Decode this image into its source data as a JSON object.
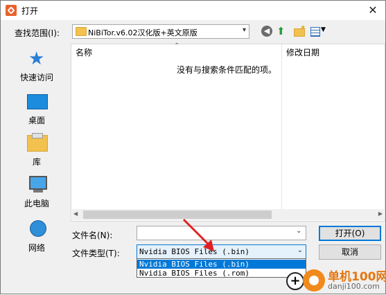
{
  "window": {
    "title": "打开",
    "close_glyph": "✕"
  },
  "lookin": {
    "label": "查找范围(I):",
    "value": "NiBiTor.v6.02汉化版+英文原版"
  },
  "toolbar": {
    "icons": [
      "back-icon",
      "up-folder-icon",
      "new-folder-icon",
      "view-menu-icon"
    ]
  },
  "places": [
    {
      "label": "快速访问",
      "icon": "star-icon"
    },
    {
      "label": "桌面",
      "icon": "desktop-icon"
    },
    {
      "label": "库",
      "icon": "library-icon"
    },
    {
      "label": "此电脑",
      "icon": "computer-icon"
    },
    {
      "label": "网络",
      "icon": "network-icon"
    }
  ],
  "list": {
    "columns": [
      "名称",
      "修改日期"
    ],
    "empty_message": "没有与搜索条件匹配的项。"
  },
  "filename": {
    "label": "文件名(N):",
    "value": ""
  },
  "filetype": {
    "label": "文件类型(T):",
    "selected": "Nvidia BIOS Files (.bin)",
    "options": [
      "Nvidia BIOS Files (.bin)",
      "Nvidia BIOS Files (.rom)"
    ]
  },
  "buttons": {
    "open": "打开(O)",
    "cancel": "取消"
  },
  "watermark": {
    "name": "单机100网",
    "url": "danji100.com"
  },
  "colors": {
    "accent": "#0078d7",
    "annotation_arrow": "#e02020",
    "watermark": "#e57712"
  }
}
